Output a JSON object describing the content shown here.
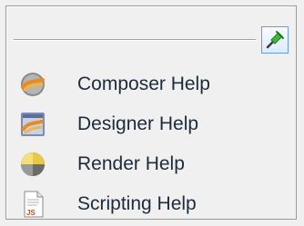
{
  "header": {
    "pin_icon": "pin-icon",
    "accent_color": "#3cba3a"
  },
  "menu": {
    "items": [
      {
        "label": "Composer Help",
        "icon": "composer-icon"
      },
      {
        "label": "Designer Help",
        "icon": "designer-icon"
      },
      {
        "label": "Render Help",
        "icon": "render-icon"
      },
      {
        "label": "Scripting Help",
        "icon": "scripting-icon"
      }
    ]
  },
  "scripting_icon_text": "JS"
}
